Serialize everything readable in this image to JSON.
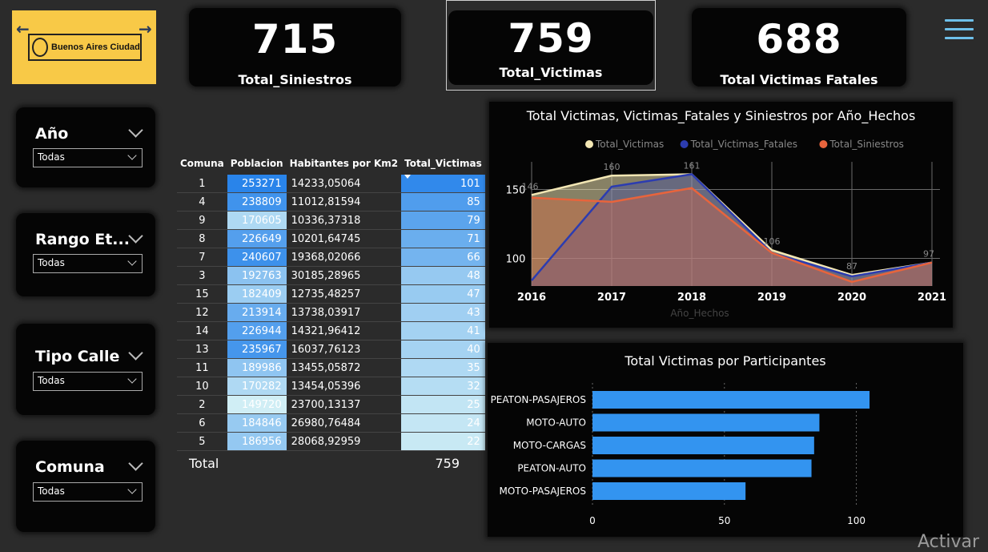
{
  "header": {
    "logo_text": "Buenos Aires Ciudad",
    "back_arrow": "←",
    "forward_arrow": "→",
    "menu_icon": "hamburger-menu-icon"
  },
  "kpis": [
    {
      "value": "715",
      "label": "Total_Siniestros"
    },
    {
      "value": "759",
      "label": "Total_Victimas"
    },
    {
      "value": "688",
      "label": "Total Victimas Fatales"
    }
  ],
  "filters": [
    {
      "title": "Año",
      "value": "Todas"
    },
    {
      "title": "Rango Et...",
      "value": "Todas"
    },
    {
      "title": "Tipo Calle",
      "value": "Todas"
    },
    {
      "title": "Comuna",
      "value": "Todas"
    }
  ],
  "table": {
    "headers": [
      "Comuna",
      "Poblacion",
      "Habitantes por Km2",
      "Total_Victimas"
    ],
    "rows": [
      [
        "1",
        "253271",
        "14233,05064",
        "101"
      ],
      [
        "4",
        "238809",
        "11012,81594",
        "85"
      ],
      [
        "9",
        "170605",
        "10336,37318",
        "79"
      ],
      [
        "8",
        "226649",
        "10201,64745",
        "71"
      ],
      [
        "7",
        "240607",
        "19368,02066",
        "66"
      ],
      [
        "3",
        "192763",
        "30185,28965",
        "48"
      ],
      [
        "15",
        "182409",
        "12735,48257",
        "47"
      ],
      [
        "12",
        "213914",
        "13738,03917",
        "43"
      ],
      [
        "14",
        "226944",
        "14321,96412",
        "41"
      ],
      [
        "13",
        "235967",
        "16037,76123",
        "40"
      ],
      [
        "11",
        "189986",
        "13455,05872",
        "35"
      ],
      [
        "10",
        "170282",
        "13454,05396",
        "32"
      ],
      [
        "2",
        "149720",
        "23700,13137",
        "25"
      ],
      [
        "6",
        "184846",
        "26980,76484",
        "24"
      ],
      [
        "5",
        "186956",
        "28068,92959",
        "22"
      ]
    ],
    "total_label": "Total",
    "total_value": "759"
  },
  "chart_data": [
    {
      "type": "area",
      "title": "Total Victimas, Victimas_Fatales y Siniestros por Año_Hechos",
      "xlabel": "Año_Hechos",
      "ylabel": "",
      "x": [
        "2016",
        "2017",
        "2018",
        "2019",
        "2020",
        "2021"
      ],
      "ylim": [
        80,
        170
      ],
      "yticks": [
        100,
        150
      ],
      "grid": true,
      "legend_position": "top",
      "series": [
        {
          "name": "Total_Victimas",
          "color": "#f3e7b4",
          "values": [
            146,
            160,
            161,
            106,
            88,
            97
          ],
          "labels": [
            "146",
            "160",
            "161",
            "106",
            "87",
            "97"
          ]
        },
        {
          "name": "Total_Victimas_Fatales",
          "color": "#2c3cb0",
          "values": [
            84,
            152,
            161,
            104,
            87,
            97
          ]
        },
        {
          "name": "Total_Siniestros",
          "color": "#e8643c",
          "values": [
            144,
            141,
            151,
            104,
            83,
            97
          ]
        }
      ]
    },
    {
      "type": "bar",
      "orientation": "horizontal",
      "title": "Total Victimas por Participantes",
      "categories": [
        "PEATON-PASAJEROS",
        "MOTO-AUTO",
        "MOTO-CARGAS",
        "PEATON-AUTO",
        "MOTO-PASAJEROS"
      ],
      "values": [
        105,
        86,
        84,
        83,
        58
      ],
      "color": "#3394f0",
      "xlim": [
        0,
        115
      ],
      "xticks": [
        0,
        50,
        100
      ],
      "grid": true
    }
  ],
  "watermark": "Activar"
}
